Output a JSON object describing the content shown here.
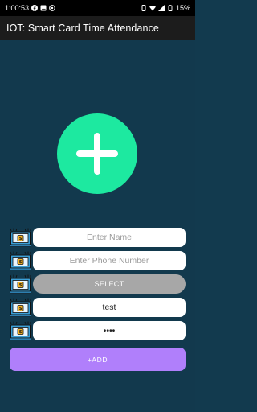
{
  "status_bar": {
    "time": "1:00:53",
    "battery": "15%",
    "left_icons": [
      "facebook-icon",
      "image-icon",
      "at-icon"
    ],
    "right_icons": [
      "vibrate-icon",
      "wifi-icon",
      "signal-icon",
      "battery-icon"
    ]
  },
  "app_bar": {
    "title": "IOT: Smart Card Time Attendance"
  },
  "photo_button": {
    "icon": "plus-icon",
    "color": "#1de9a0"
  },
  "form": {
    "name": {
      "value": "",
      "placeholder": "Enter Name"
    },
    "phone": {
      "value": "",
      "placeholder": "Enter Phone Number"
    },
    "select_label": "SELECT",
    "username": {
      "value": "test"
    },
    "password": {
      "value": "••••"
    },
    "row_icon": "card-reader-icon"
  },
  "add_button": {
    "label": "+ADD",
    "color": "#b07ffb"
  }
}
